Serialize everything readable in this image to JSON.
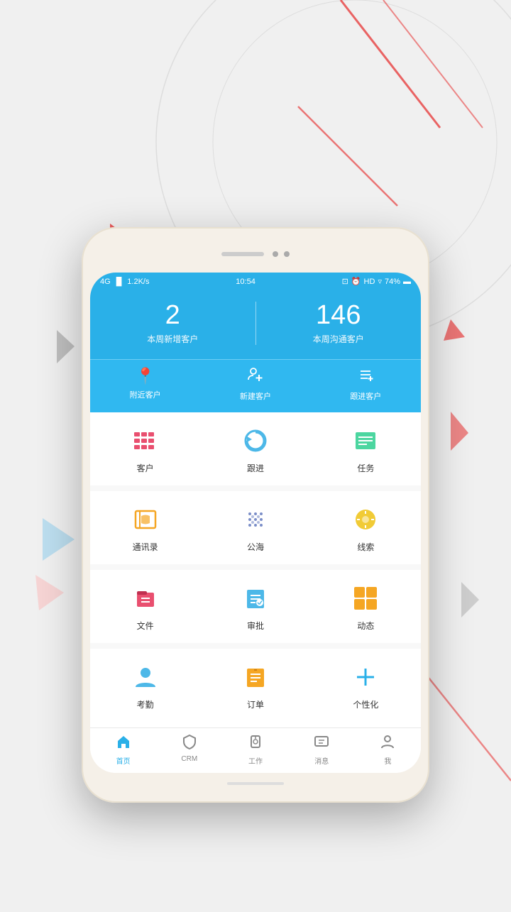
{
  "background": {
    "color": "#ececec"
  },
  "statusBar": {
    "network": "4G",
    "signal": "4G",
    "speed": "1.2K/s",
    "time": "10:54",
    "battery": "74%"
  },
  "header": {
    "stat1": {
      "number": "2",
      "label": "本周新增客户"
    },
    "stat2": {
      "number": "146",
      "label": "本周沟通客户"
    }
  },
  "quickActions": [
    {
      "icon": "📍",
      "label": "附近客户"
    },
    {
      "icon": "👥",
      "label": "新建客户"
    },
    {
      "icon": "📋",
      "label": "跟进客户"
    }
  ],
  "gridRows": [
    [
      {
        "icon": "grid1",
        "label": "客户",
        "color": "#e94f6f"
      },
      {
        "icon": "grid2",
        "label": "跟进",
        "color": "#4db8e8"
      },
      {
        "icon": "grid3",
        "label": "任务",
        "color": "#4cd6a0"
      }
    ],
    [
      {
        "icon": "grid4",
        "label": "通讯录",
        "color": "#f5a623"
      },
      {
        "icon": "grid5",
        "label": "公海",
        "color": "#7b8ec8"
      },
      {
        "icon": "grid6",
        "label": "线索",
        "color": "#f0c520"
      }
    ],
    [
      {
        "icon": "grid7",
        "label": "文件",
        "color": "#e94f6f"
      },
      {
        "icon": "grid8",
        "label": "审批",
        "color": "#4db8e8"
      },
      {
        "icon": "grid9",
        "label": "动态",
        "color": "#f5a623"
      }
    ],
    [
      {
        "icon": "grid10",
        "label": "考勤",
        "color": "#4db8e8"
      },
      {
        "icon": "grid11",
        "label": "订单",
        "color": "#f5a623"
      },
      {
        "icon": "grid12",
        "label": "个性化",
        "color": "#2ab0e8"
      }
    ]
  ],
  "bottomNav": [
    {
      "icon": "home",
      "label": "首页",
      "active": true
    },
    {
      "icon": "shield",
      "label": "CRM",
      "active": false
    },
    {
      "icon": "lock",
      "label": "工作",
      "active": false
    },
    {
      "icon": "message",
      "label": "消息",
      "active": false
    },
    {
      "icon": "person",
      "label": "我",
      "active": false
    }
  ]
}
